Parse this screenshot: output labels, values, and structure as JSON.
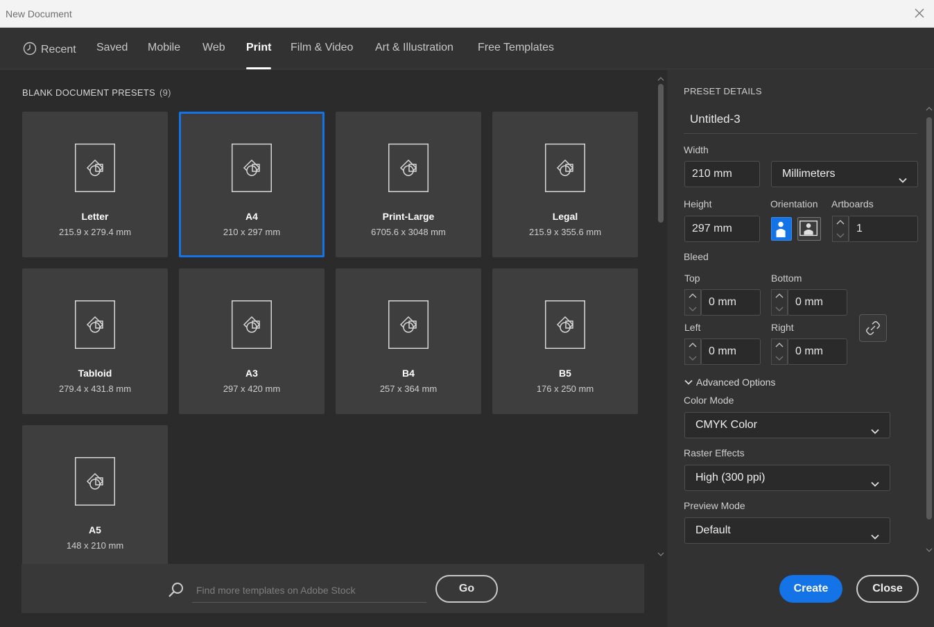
{
  "window": {
    "title": "New Document"
  },
  "tabs": [
    {
      "label": "Recent"
    },
    {
      "label": "Saved"
    },
    {
      "label": "Mobile"
    },
    {
      "label": "Web"
    },
    {
      "label": "Print",
      "active": true
    },
    {
      "label": "Film & Video"
    },
    {
      "label": "Art & Illustration"
    },
    {
      "label": "Free Templates"
    }
  ],
  "presets": {
    "heading": "BLANK DOCUMENT PRESETS",
    "count": "(9)",
    "items": [
      {
        "name": "Letter",
        "dims": "215.9 x 279.4 mm"
      },
      {
        "name": "A4",
        "dims": "210 x 297 mm",
        "selected": true
      },
      {
        "name": "Print-Large",
        "dims": "6705.6 x 3048 mm"
      },
      {
        "name": "Legal",
        "dims": "215.9 x 355.6 mm"
      },
      {
        "name": "Tabloid",
        "dims": "279.4 x 431.8 mm"
      },
      {
        "name": "A3",
        "dims": "297 x 420 mm"
      },
      {
        "name": "B4",
        "dims": "257 x 364 mm"
      },
      {
        "name": "B5",
        "dims": "176 x 250 mm"
      },
      {
        "name": "A5",
        "dims": "148 x 210 mm"
      }
    ]
  },
  "search": {
    "placeholder": "Find more templates on Adobe Stock",
    "go_label": "Go"
  },
  "details": {
    "heading": "PRESET DETAILS",
    "name": "Untitled-3",
    "width_label": "Width",
    "width_value": "210 mm",
    "units": "Millimeters",
    "height_label": "Height",
    "height_value": "297 mm",
    "orientation_label": "Orientation",
    "artboards_label": "Artboards",
    "artboards_value": "1",
    "bleed_label": "Bleed",
    "top_label": "Top",
    "top_value": "0 mm",
    "bottom_label": "Bottom",
    "bottom_value": "0 mm",
    "left_label": "Left",
    "left_value": "0 mm",
    "right_label": "Right",
    "right_value": "0 mm",
    "advanced_label": "Advanced Options",
    "color_mode_label": "Color Mode",
    "color_mode_value": "CMYK Color",
    "raster_label": "Raster Effects",
    "raster_value": "High (300 ppi)",
    "preview_label": "Preview Mode",
    "preview_value": "Default"
  },
  "actions": {
    "create_label": "Create",
    "close_label": "Close"
  },
  "colors": {
    "accent": "#1473e6",
    "background": "#2b2b2b",
    "panel": "#323232"
  }
}
